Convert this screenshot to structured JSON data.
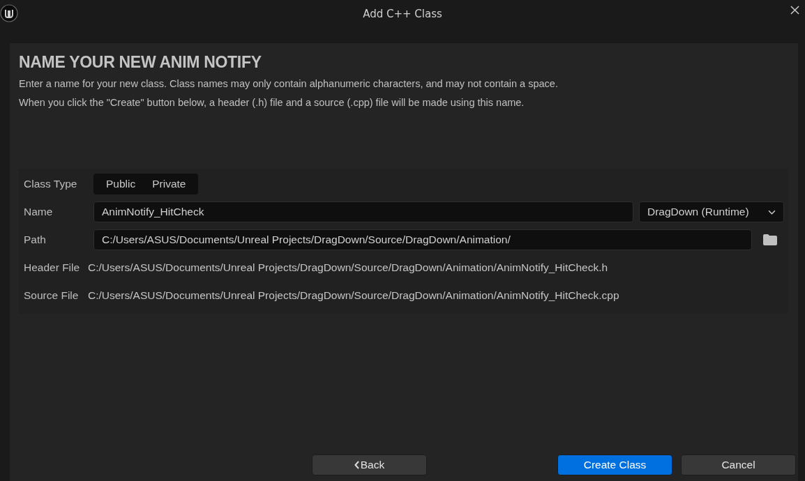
{
  "window": {
    "title": "Add C++ Class"
  },
  "heading": "NAME YOUR NEW ANIM NOTIFY",
  "description": [
    "Enter a name for your new class. Class names may only contain alphanumeric characters, and may not contain a space.",
    "When you click the \"Create\" button below, a header (.h) file and a source (.cpp) file will be made using this name."
  ],
  "form": {
    "class_type": {
      "label": "Class Type",
      "options": [
        {
          "label": "Public",
          "selected": false
        },
        {
          "label": "Private",
          "selected": false
        }
      ]
    },
    "name": {
      "label": "Name",
      "value": "AnimNotify_HitCheck",
      "module": "DragDown (Runtime)"
    },
    "path": {
      "label": "Path",
      "value": "C:/Users/ASUS/Documents/Unreal Projects/DragDown/Source/DragDown/Animation/"
    },
    "header_file": {
      "label": "Header File",
      "value": "C:/Users/ASUS/Documents/Unreal Projects/DragDown/Source/DragDown/Animation/AnimNotify_HitCheck.h"
    },
    "source_file": {
      "label": "Source File",
      "value": "C:/Users/ASUS/Documents/Unreal Projects/DragDown/Source/DragDown/Animation/AnimNotify_HitCheck.cpp"
    }
  },
  "buttons": [
    {
      "label": "Back",
      "kind": "back"
    },
    {
      "label": "Create Class",
      "kind": "primary"
    },
    {
      "label": "Cancel",
      "kind": "normal"
    }
  ]
}
